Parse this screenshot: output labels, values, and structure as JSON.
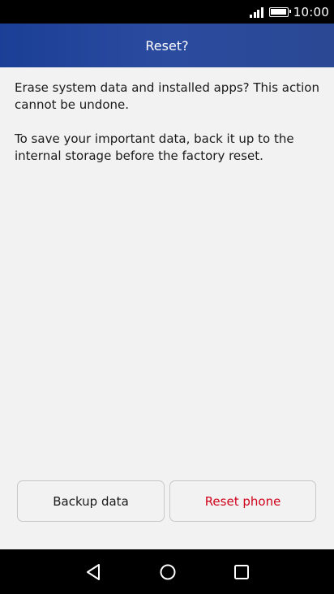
{
  "status_bar": {
    "time": "10:00",
    "icons": [
      "signal-icon",
      "battery-icon"
    ]
  },
  "dialog": {
    "title": "Reset?",
    "message_1": "Erase system data and installed apps? This action cannot be undone.",
    "message_2": "To save your important data, back it up to the internal storage before the factory reset."
  },
  "buttons": {
    "backup_label": "Backup data",
    "reset_label": "Reset phone"
  },
  "nav_bar": {
    "icons": [
      "back-icon",
      "home-icon",
      "recents-icon"
    ]
  },
  "colors": {
    "title_bar": "#2a4893",
    "reset_text": "#d0021b",
    "background": "#f2f2f2"
  }
}
